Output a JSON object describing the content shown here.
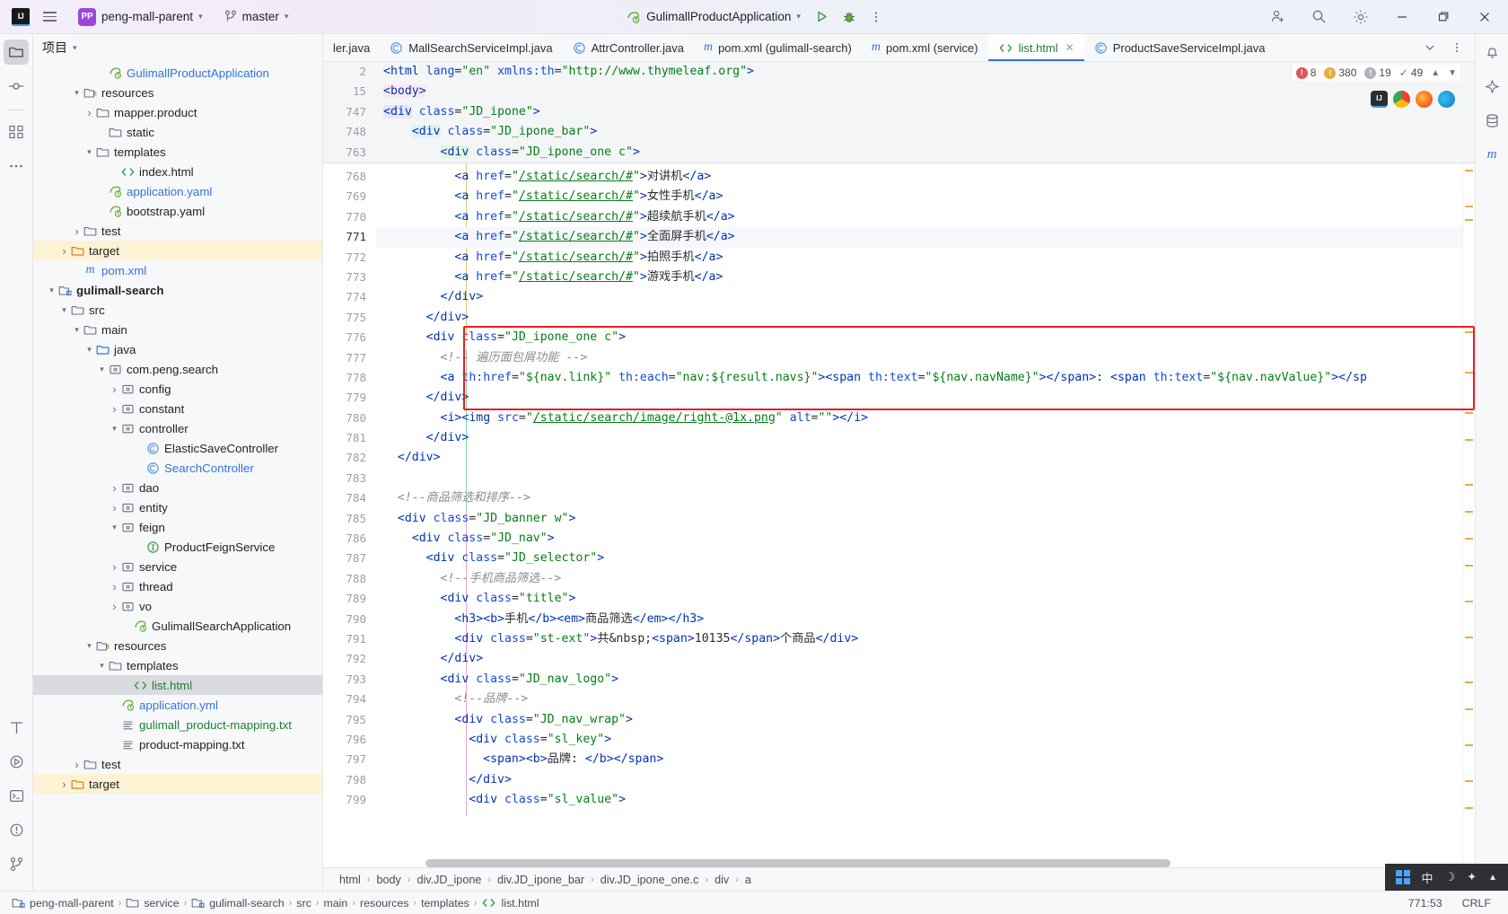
{
  "titlebar": {
    "logo": "IJ",
    "menu_icon": "hamburger-menu-icon",
    "project_badge": "PP",
    "project_name": "peng-mall-parent",
    "branch_icon": "git-branch-icon",
    "branch_name": "master",
    "run_config": "GulimallProductApplication",
    "run_icon": "run-icon",
    "debug_icon": "debug-icon",
    "more_icon": "more-vertical-icon",
    "account_icon": "add-account-icon",
    "search_icon": "search-icon",
    "settings_icon": "gear-icon",
    "minimize": "minimize-icon",
    "maximize": "maximize-icon",
    "close": "close-icon"
  },
  "rail": {
    "project_icon": "folder-project-icon",
    "commit_icon": "commit-icon",
    "structure_icon": "structure-icon",
    "more_icon": "more-tool-windows-icon",
    "bottom": [
      {
        "icon": "terminal-structure-icon"
      },
      {
        "icon": "run-tool-icon"
      },
      {
        "icon": "terminal-icon"
      },
      {
        "icon": "problems-icon"
      },
      {
        "icon": "version-control-icon"
      }
    ]
  },
  "project_panel": {
    "title": "项目",
    "tree": [
      {
        "indent": 5,
        "arrow": "",
        "icon": "spring-app-icon",
        "label": "GulimallProductApplication",
        "color": "blue"
      },
      {
        "indent": 3,
        "arrow": "v",
        "icon": "resources-folder-icon",
        "label": "resources",
        "color": ""
      },
      {
        "indent": 4,
        "arrow": ">",
        "icon": "folder-icon",
        "label": "mapper.product",
        "color": ""
      },
      {
        "indent": 5,
        "arrow": "",
        "icon": "folder-icon",
        "label": "static",
        "color": ""
      },
      {
        "indent": 4,
        "arrow": "v",
        "icon": "folder-icon",
        "label": "templates",
        "color": ""
      },
      {
        "indent": 6,
        "arrow": "",
        "icon": "html-file-icon",
        "label": "index.html",
        "color": ""
      },
      {
        "indent": 5,
        "arrow": "",
        "icon": "spring-yaml-icon",
        "label": "application.yaml",
        "color": "blue"
      },
      {
        "indent": 5,
        "arrow": "",
        "icon": "spring-yaml-icon",
        "label": "bootstrap.yaml",
        "color": ""
      },
      {
        "indent": 3,
        "arrow": ">",
        "icon": "folder-icon",
        "label": "test",
        "color": ""
      },
      {
        "indent": 2,
        "arrow": ">",
        "icon": "folder-orange-icon",
        "label": "target",
        "color": "",
        "highlight": "target"
      },
      {
        "indent": 3,
        "arrow": "",
        "icon": "maven-icon",
        "label": "pom.xml",
        "color": "blue"
      },
      {
        "indent": 1,
        "arrow": "v",
        "icon": "module-icon",
        "label": "gulimall-search",
        "color": "",
        "bold": true
      },
      {
        "indent": 2,
        "arrow": "v",
        "icon": "folder-icon",
        "label": "src",
        "color": ""
      },
      {
        "indent": 3,
        "arrow": "v",
        "icon": "folder-icon",
        "label": "main",
        "color": ""
      },
      {
        "indent": 4,
        "arrow": "v",
        "icon": "sources-folder-icon",
        "label": "java",
        "color": ""
      },
      {
        "indent": 5,
        "arrow": "v",
        "icon": "package-icon",
        "label": "com.peng.search",
        "color": ""
      },
      {
        "indent": 6,
        "arrow": ">",
        "icon": "package-icon",
        "label": "config",
        "color": ""
      },
      {
        "indent": 6,
        "arrow": ">",
        "icon": "package-icon",
        "label": "constant",
        "color": ""
      },
      {
        "indent": 6,
        "arrow": "v",
        "icon": "package-icon",
        "label": "controller",
        "color": ""
      },
      {
        "indent": 8,
        "arrow": "",
        "icon": "class-icon",
        "label": "ElasticSaveController",
        "color": ""
      },
      {
        "indent": 8,
        "arrow": "",
        "icon": "class-icon",
        "label": "SearchController",
        "color": "blue"
      },
      {
        "indent": 6,
        "arrow": ">",
        "icon": "package-icon",
        "label": "dao",
        "color": ""
      },
      {
        "indent": 6,
        "arrow": ">",
        "icon": "package-icon",
        "label": "entity",
        "color": ""
      },
      {
        "indent": 6,
        "arrow": "v",
        "icon": "package-icon",
        "label": "feign",
        "color": ""
      },
      {
        "indent": 8,
        "arrow": "",
        "icon": "interface-icon",
        "label": "ProductFeignService",
        "color": ""
      },
      {
        "indent": 6,
        "arrow": ">",
        "icon": "package-icon",
        "label": "service",
        "color": ""
      },
      {
        "indent": 6,
        "arrow": ">",
        "icon": "package-icon",
        "label": "thread",
        "color": ""
      },
      {
        "indent": 6,
        "arrow": ">",
        "icon": "package-icon",
        "label": "vo",
        "color": ""
      },
      {
        "indent": 7,
        "arrow": "",
        "icon": "spring-app-icon",
        "label": "GulimallSearchApplication",
        "color": ""
      },
      {
        "indent": 4,
        "arrow": "v",
        "icon": "resources-folder-icon",
        "label": "resources",
        "color": ""
      },
      {
        "indent": 5,
        "arrow": "v",
        "icon": "folder-icon",
        "label": "templates",
        "color": ""
      },
      {
        "indent": 7,
        "arrow": "",
        "icon": "html-file-icon",
        "label": "list.html",
        "color": "green",
        "selected": true
      },
      {
        "indent": 6,
        "arrow": "",
        "icon": "spring-yaml-icon",
        "label": "application.yml",
        "color": "blue"
      },
      {
        "indent": 6,
        "arrow": "",
        "icon": "text-file-icon",
        "label": "gulimall_product-mapping.txt",
        "color": "green"
      },
      {
        "indent": 6,
        "arrow": "",
        "icon": "text-file-icon",
        "label": "product-mapping.txt",
        "color": ""
      },
      {
        "indent": 3,
        "arrow": ">",
        "icon": "folder-icon",
        "label": "test",
        "color": ""
      },
      {
        "indent": 2,
        "arrow": ">",
        "icon": "folder-orange-icon",
        "label": "target",
        "color": "",
        "highlight": "target"
      }
    ]
  },
  "editor_tabs": {
    "tabs": [
      {
        "label": "ler.java",
        "icon": "class-icon",
        "clipped": true,
        "active": false
      },
      {
        "label": "MallSearchServiceImpl.java",
        "icon": "class-icon",
        "active": false
      },
      {
        "label": "AttrController.java",
        "icon": "class-icon",
        "active": false
      },
      {
        "label": "pom.xml (gulimall-search)",
        "icon": "maven-icon",
        "active": false
      },
      {
        "label": "pom.xml (service)",
        "icon": "maven-icon",
        "active": false
      },
      {
        "label": "list.html",
        "icon": "html-file-icon",
        "active": true,
        "closable": true
      },
      {
        "label": "ProductSaveServiceImpl.java",
        "icon": "class-icon",
        "active": false
      }
    ],
    "overflow_icon": "chevron-down-icon",
    "tab_options_icon": "more-vertical-icon"
  },
  "inspections": {
    "errors": "8",
    "warnings": "380",
    "weak_warnings": "19",
    "typos": "49",
    "up_icon": "chevron-up-icon",
    "down_icon": "chevron-down-icon"
  },
  "browsers": [
    {
      "name": "intellij-preview-icon",
      "letter": "IJ",
      "color": "#2b2d30"
    },
    {
      "name": "chrome-icon",
      "letter": "",
      "color": "#4285f4"
    },
    {
      "name": "firefox-icon",
      "letter": "",
      "color": "#ff7139"
    },
    {
      "name": "edge-icon",
      "letter": "",
      "color": "#0f7ac1"
    }
  ],
  "sticky_lines": [
    {
      "num": "2",
      "html": "html-line"
    },
    {
      "num": "15",
      "html": "body-line"
    },
    {
      "num": "747",
      "html": "jd-ipone-line"
    },
    {
      "num": "748",
      "html": "jd-ipone-bar-line"
    },
    {
      "num": "763",
      "html": "jd-ipone-one-c-line"
    }
  ],
  "code": {
    "lines": [
      {
        "num": "768",
        "indent": 10,
        "text": "<a href=\"/static/search/#\">对讲机</a>"
      },
      {
        "num": "769",
        "indent": 10,
        "text": "<a href=\"/static/search/#\">女性手机</a>"
      },
      {
        "num": "770",
        "indent": 10,
        "text": "<a href=\"/static/search/#\">超续航手机</a>"
      },
      {
        "num": "771",
        "indent": 10,
        "text": "<a href=\"/static/search/#\">全面屏手机</a>",
        "current": true
      },
      {
        "num": "772",
        "indent": 10,
        "text": "<a href=\"/static/search/#\">拍照手机</a>"
      },
      {
        "num": "773",
        "indent": 10,
        "text": "<a href=\"/static/search/#\">游戏手机</a>"
      },
      {
        "num": "774",
        "indent": 8,
        "text": "</div>"
      },
      {
        "num": "775",
        "indent": 6,
        "text": "</div>"
      },
      {
        "num": "776",
        "indent": 6,
        "text": "<div class=\"JD_ipone_one c\">"
      },
      {
        "num": "777",
        "indent": 8,
        "text": "<!-- 遍历面包屑功能 -->"
      },
      {
        "num": "778",
        "indent": 8,
        "text": "<a th:href=\"${nav.link}\" th:each=\"nav:${result.navs}\"><span th:text=\"${nav.navName}\"></span>: <span th:text=\"${nav.navValue}\"></sp"
      },
      {
        "num": "779",
        "indent": 6,
        "text": "</div>"
      },
      {
        "num": "780",
        "indent": 8,
        "text": "<i><img src=\"/static/search/image/right-@1x.png\" alt=\"\"></i>"
      },
      {
        "num": "781",
        "indent": 6,
        "text": "</div>"
      },
      {
        "num": "782",
        "indent": 2,
        "text": "</div>"
      },
      {
        "num": "783",
        "indent": 0,
        "text": ""
      },
      {
        "num": "784",
        "indent": 2,
        "text": "<!--商品筛选和排序-->"
      },
      {
        "num": "785",
        "indent": 2,
        "text": "<div class=\"JD_banner w\">"
      },
      {
        "num": "786",
        "indent": 4,
        "text": "<div class=\"JD_nav\">"
      },
      {
        "num": "787",
        "indent": 6,
        "text": "<div class=\"JD_selector\">"
      },
      {
        "num": "788",
        "indent": 8,
        "text": "<!--手机商品筛选-->"
      },
      {
        "num": "789",
        "indent": 8,
        "text": "<div class=\"title\">"
      },
      {
        "num": "790",
        "indent": 10,
        "text": "<h3><b>手机</b><em>商品筛选</em></h3>"
      },
      {
        "num": "791",
        "indent": 10,
        "text": "<div class=\"st-ext\">共&nbsp;<span>10135</span>个商品</div>"
      },
      {
        "num": "792",
        "indent": 8,
        "text": "</div>"
      },
      {
        "num": "793",
        "indent": 8,
        "text": "<div class=\"JD_nav_logo\">"
      },
      {
        "num": "794",
        "indent": 10,
        "text": "<!--品牌-->"
      },
      {
        "num": "795",
        "indent": 10,
        "text": "<div class=\"JD_nav_wrap\">"
      },
      {
        "num": "796",
        "indent": 12,
        "text": "<div class=\"sl_key\">"
      },
      {
        "num": "797",
        "indent": 14,
        "text": "<span><b>品牌: </b></span>"
      },
      {
        "num": "798",
        "indent": 12,
        "text": "</div>"
      },
      {
        "num": "799",
        "indent": 12,
        "text": "<div class=\"sl_value\">"
      }
    ]
  },
  "breadcrumbs": {
    "items": [
      "html",
      "body",
      "div.JD_ipone",
      "div.JD_ipone_bar",
      "div.JD_ipone_one.c",
      "div",
      "a"
    ]
  },
  "status_bar": {
    "left_items": [
      {
        "icon": "module-icon",
        "label": "peng-mall-parent"
      },
      {
        "icon": "folder-icon",
        "label": "service"
      },
      {
        "icon": "module-icon",
        "label": "gulimall-search"
      },
      {
        "icon": "",
        "label": "src"
      },
      {
        "icon": "",
        "label": "main"
      },
      {
        "icon": "",
        "label": "resources"
      },
      {
        "icon": "",
        "label": "templates"
      },
      {
        "icon": "html-file-icon",
        "label": "list.html"
      }
    ],
    "caret": "771:53",
    "line_sep": "CRLF"
  },
  "tray": {
    "grid_icon": "app-grid-icon",
    "ime_label": "中",
    "moon_icon": "moon-icon",
    "quick_icon": "quick-icon",
    "chevron_icon": "chevron-up-icon"
  }
}
